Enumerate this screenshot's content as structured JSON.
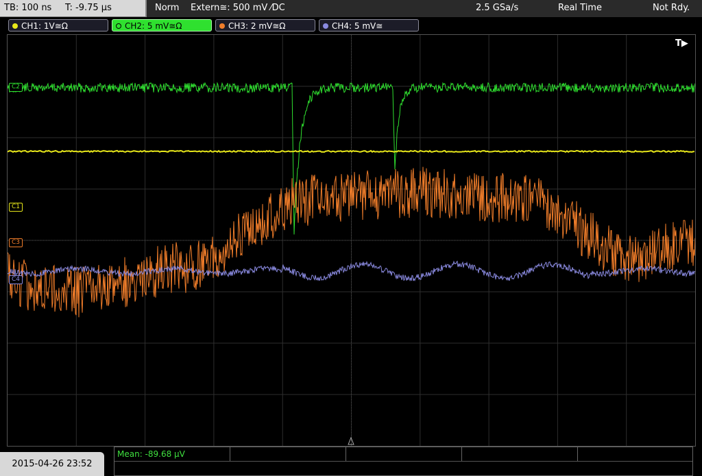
{
  "header": {
    "timebase": "TB: 100 ns",
    "trigger_time": "T: -9.75 µs",
    "mode": "Norm",
    "trigger": "Extern≅: 500 mV ⁄DC",
    "sample_rate": "2.5 GSa/s",
    "acq_mode": "Real Time",
    "status": "Not Rdy."
  },
  "channels": [
    {
      "label": "CH1: 1V≅Ω",
      "color": "#e8e81a"
    },
    {
      "label": "CH2: 5 mV≅Ω",
      "color": "#2fe02f"
    },
    {
      "label": "CH3: 2 mV≅Ω",
      "color": "#f07d2a"
    },
    {
      "label": "CH4: 5 mV≅",
      "color": "#8a8ae0"
    }
  ],
  "markers": {
    "c1": "C1",
    "c2": "C2",
    "c3": "C3",
    "c4": "C4",
    "trigger": "T▶"
  },
  "measurement": {
    "mean": "Mean: -89.68 µV"
  },
  "datetime": "2015-04-26 23:52"
}
